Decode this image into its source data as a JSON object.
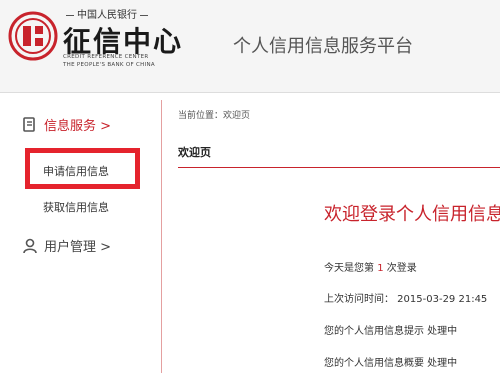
{
  "header": {
    "logo_top": "中国人民银行",
    "logo_main": "征信中心",
    "logo_en_line1": "CREDIT REFERENCE CENTER",
    "logo_en_line2": "THE PEOPLE'S BANK OF CHINA",
    "platform_title": "个人信用信息服务平台"
  },
  "sidebar": {
    "service_label": "信息服务 >",
    "sub_items": [
      "申请信用信息",
      "获取信用信息"
    ],
    "user_label": "用户管理 >"
  },
  "main": {
    "breadcrumb": "当前位置：欢迎页",
    "section_title": "欢迎页",
    "welcome_title": "欢迎登录个人信用信息",
    "login_prefix": "今天是您第",
    "login_count": "1",
    "login_suffix": "次登录",
    "last_visit": "上次访问时间： 2015-03-29 21:45",
    "status_line1": "您的个人信用信息提示 处理中",
    "status_line2": "您的个人信用信息概要 处理中"
  },
  "colors": {
    "accent": "#c8232c",
    "highlight": "#e5232d"
  },
  "icons": [
    "seal-logo-icon",
    "document-icon",
    "user-icon"
  ]
}
